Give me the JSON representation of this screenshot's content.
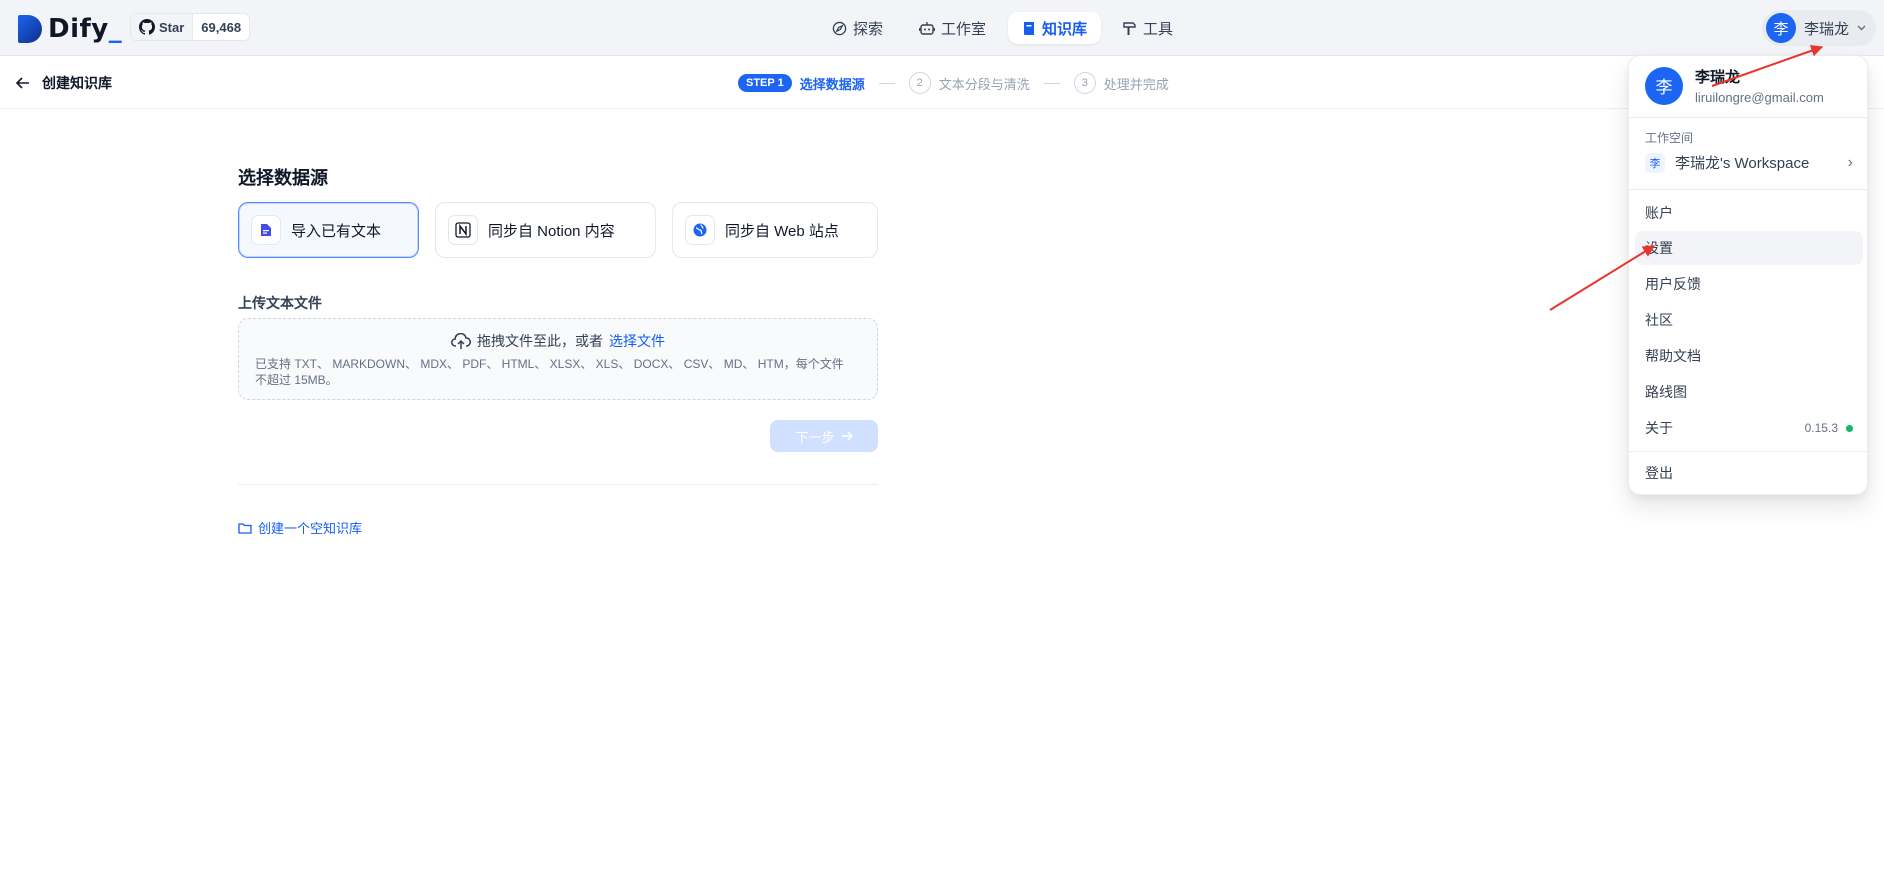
{
  "header": {
    "logo": "Dify",
    "github": {
      "star_label": "Star",
      "star_count": "69,468"
    },
    "nav": [
      {
        "label": "探索"
      },
      {
        "label": "工作室"
      },
      {
        "label": "知识库"
      },
      {
        "label": "工具"
      }
    ],
    "user": {
      "avatar": "李",
      "name": "李瑞龙"
    }
  },
  "subheader": {
    "back_label": "创建知识库",
    "steps": [
      {
        "badge": "STEP 1",
        "label": "选择数据源"
      },
      {
        "number": "2",
        "label": "文本分段与清洗"
      },
      {
        "number": "3",
        "label": "处理并完成"
      }
    ]
  },
  "main": {
    "title": "选择数据源",
    "sources": [
      {
        "label": "导入已有文本"
      },
      {
        "label": "同步自 Notion 内容"
      },
      {
        "label": "同步自 Web 站点"
      }
    ],
    "upload_label": "上传文本文件",
    "dropzone": {
      "text": "拖拽文件至此，或者",
      "link": "选择文件",
      "hint": "已支持 TXT、 MARKDOWN、 MDX、 PDF、 HTML、 XLSX、 XLS、 DOCX、 CSV、 MD、 HTM，每个文件不超过 15MB。"
    },
    "next_label": "下一步",
    "create_empty_label": "创建一个空知识库"
  },
  "menu": {
    "user": {
      "avatar": "李",
      "name": "李瑞龙",
      "email": "liruilongre@gmail.com"
    },
    "workspace_label": "工作空间",
    "workspace": {
      "avatar": "李",
      "name": "李瑞龙's Workspace"
    },
    "items": {
      "account": "账户",
      "settings": "设置",
      "feedback": "用户反馈",
      "community": "社区",
      "help": "帮助文档",
      "roadmap": "路线图",
      "about": "关于",
      "version": "0.15.3",
      "logout": "登出"
    }
  },
  "colors": {
    "accent": "#1c64f2",
    "annotation": "#e8362c",
    "status_ok": "#12b76a"
  }
}
